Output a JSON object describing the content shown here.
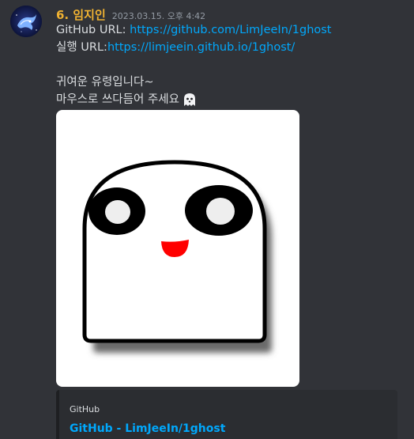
{
  "message": {
    "author": "6. 임지인",
    "timestamp": "2023.03.15. 오후 4:42",
    "lines": {
      "github_prefix": "GitHub URL: ",
      "github_url": "https://github.com/LimJeeIn/1ghost",
      "run_prefix": "실행 URL:",
      "run_url": "https://limjeein.github.io/1ghost/",
      "line3": "귀여운 유령입니다~",
      "line4": "마우스로 쓰다듬어 주세요"
    },
    "emoji": "ghost-icon"
  },
  "embed": {
    "provider": "GitHub",
    "title": "GitHub - LimJeeIn/1ghost"
  },
  "colors": {
    "background": "#313338",
    "username": "#f0b232",
    "link": "#00a8fc",
    "text": "#dbdee1",
    "ghost_mouth": "#ff0000"
  }
}
